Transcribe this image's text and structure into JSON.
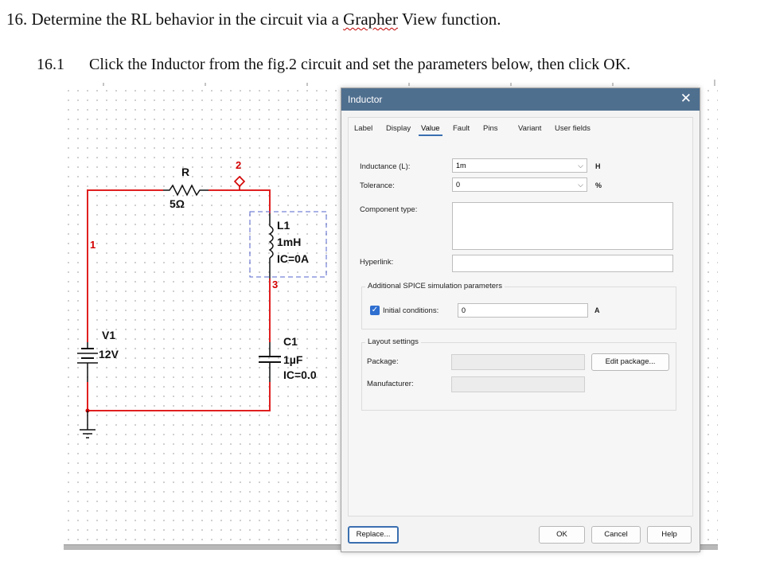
{
  "document": {
    "question": {
      "number": "16.",
      "text_before": "Determine the RL behavior in the circuit via a ",
      "squiggle_word": "Grapher",
      "text_after": " View function."
    },
    "step": {
      "number": "16.1",
      "text": "Click the Inductor from the fig.2 circuit and set the parameters below, then click OK."
    }
  },
  "circuit": {
    "resistor": {
      "name": "R",
      "value": "5Ω"
    },
    "inductor": {
      "name": "L1",
      "value": "1mH",
      "ic": "IC=0A"
    },
    "capacitor": {
      "name": "C1",
      "value": "1µF",
      "ic": "IC=0.0"
    },
    "source": {
      "name": "V1",
      "value": "12V"
    },
    "nodes": {
      "n1": "1",
      "n2": "2",
      "n3": "3"
    },
    "wire_color": "#e02020",
    "node_color": "#d40000"
  },
  "dialog": {
    "title": "Inductor",
    "close_glyph": "✕",
    "tabs": [
      "Label",
      "Display",
      "Value",
      "Fault",
      "Pins",
      "Variant",
      "User fields"
    ],
    "active_tab": "Value",
    "fields": {
      "inductance_label": "Inductance (L):",
      "inductance_value": "1m",
      "inductance_unit": "H",
      "tolerance_label": "Tolerance:",
      "tolerance_value": "0",
      "tolerance_unit": "%",
      "component_type_label": "Component type:",
      "component_type_value": "",
      "hyperlink_label": "Hyperlink:",
      "hyperlink_value": ""
    },
    "spice": {
      "group_title": "Additional SPICE simulation parameters",
      "initial_conditions_label": "Initial conditions:",
      "initial_conditions_checked": true,
      "initial_conditions_value": "0",
      "initial_conditions_unit": "A"
    },
    "layout": {
      "group_title": "Layout settings",
      "package_label": "Package:",
      "package_value": "",
      "manufacturer_label": "Manufacturer:",
      "manufacturer_value": "",
      "edit_package_button": "Edit package..."
    },
    "buttons": {
      "replace": "Replace...",
      "ok": "OK",
      "cancel": "Cancel",
      "help": "Help"
    },
    "titlebar_color": "#4f6f8f",
    "accent_color": "#2f6fd0"
  },
  "icons": {
    "close": "close-icon",
    "dropdown": "chevron-down-icon",
    "check": "checkmark-icon"
  }
}
